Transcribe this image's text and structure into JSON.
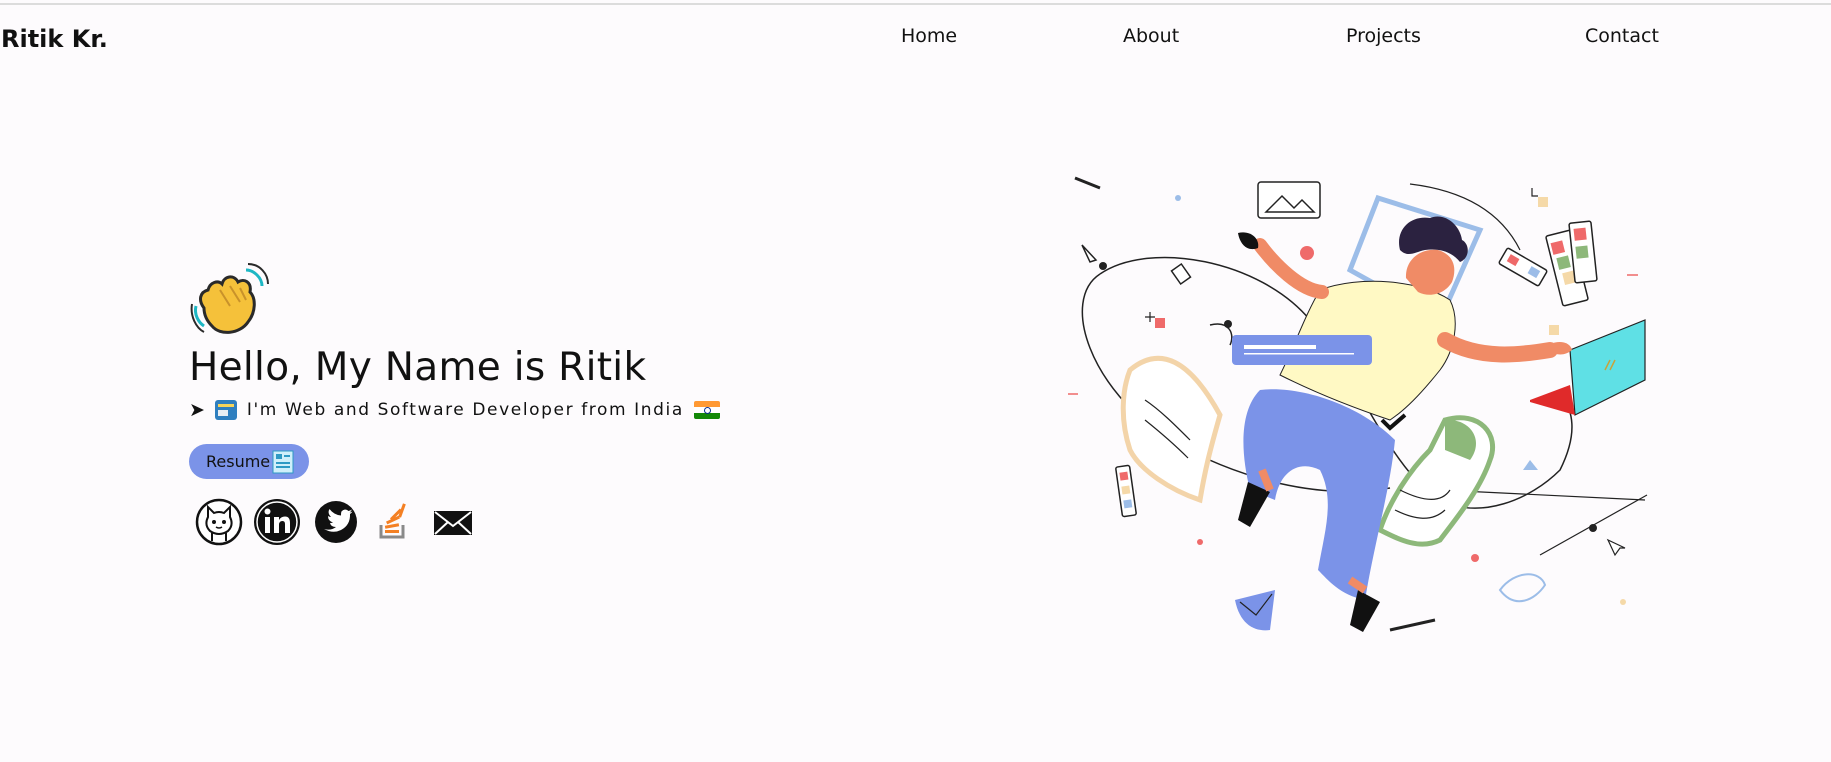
{
  "brand": "Ritik Kr.",
  "nav": {
    "items": [
      "Home",
      "About",
      "Projects",
      "Contact"
    ]
  },
  "hero": {
    "greeting": "Hello, My Name is Ritik",
    "tagline_prefix": "➤",
    "tagline": "I'm Web and Software Developer from India",
    "resume_label": "Resume"
  },
  "social": {
    "icons": [
      "github-icon",
      "linkedin-icon",
      "twitter-icon",
      "stackoverflow-icon",
      "email-icon"
    ]
  },
  "colors": {
    "accent": "#7b93e8",
    "background": "#fdfbfd",
    "illustration_blue": "#7b93e8",
    "illustration_skin": "#f08b66",
    "illustration_shirt": "#fff9c4",
    "illustration_laptop": "#5fe0e5",
    "illustration_green": "#8db87a"
  }
}
